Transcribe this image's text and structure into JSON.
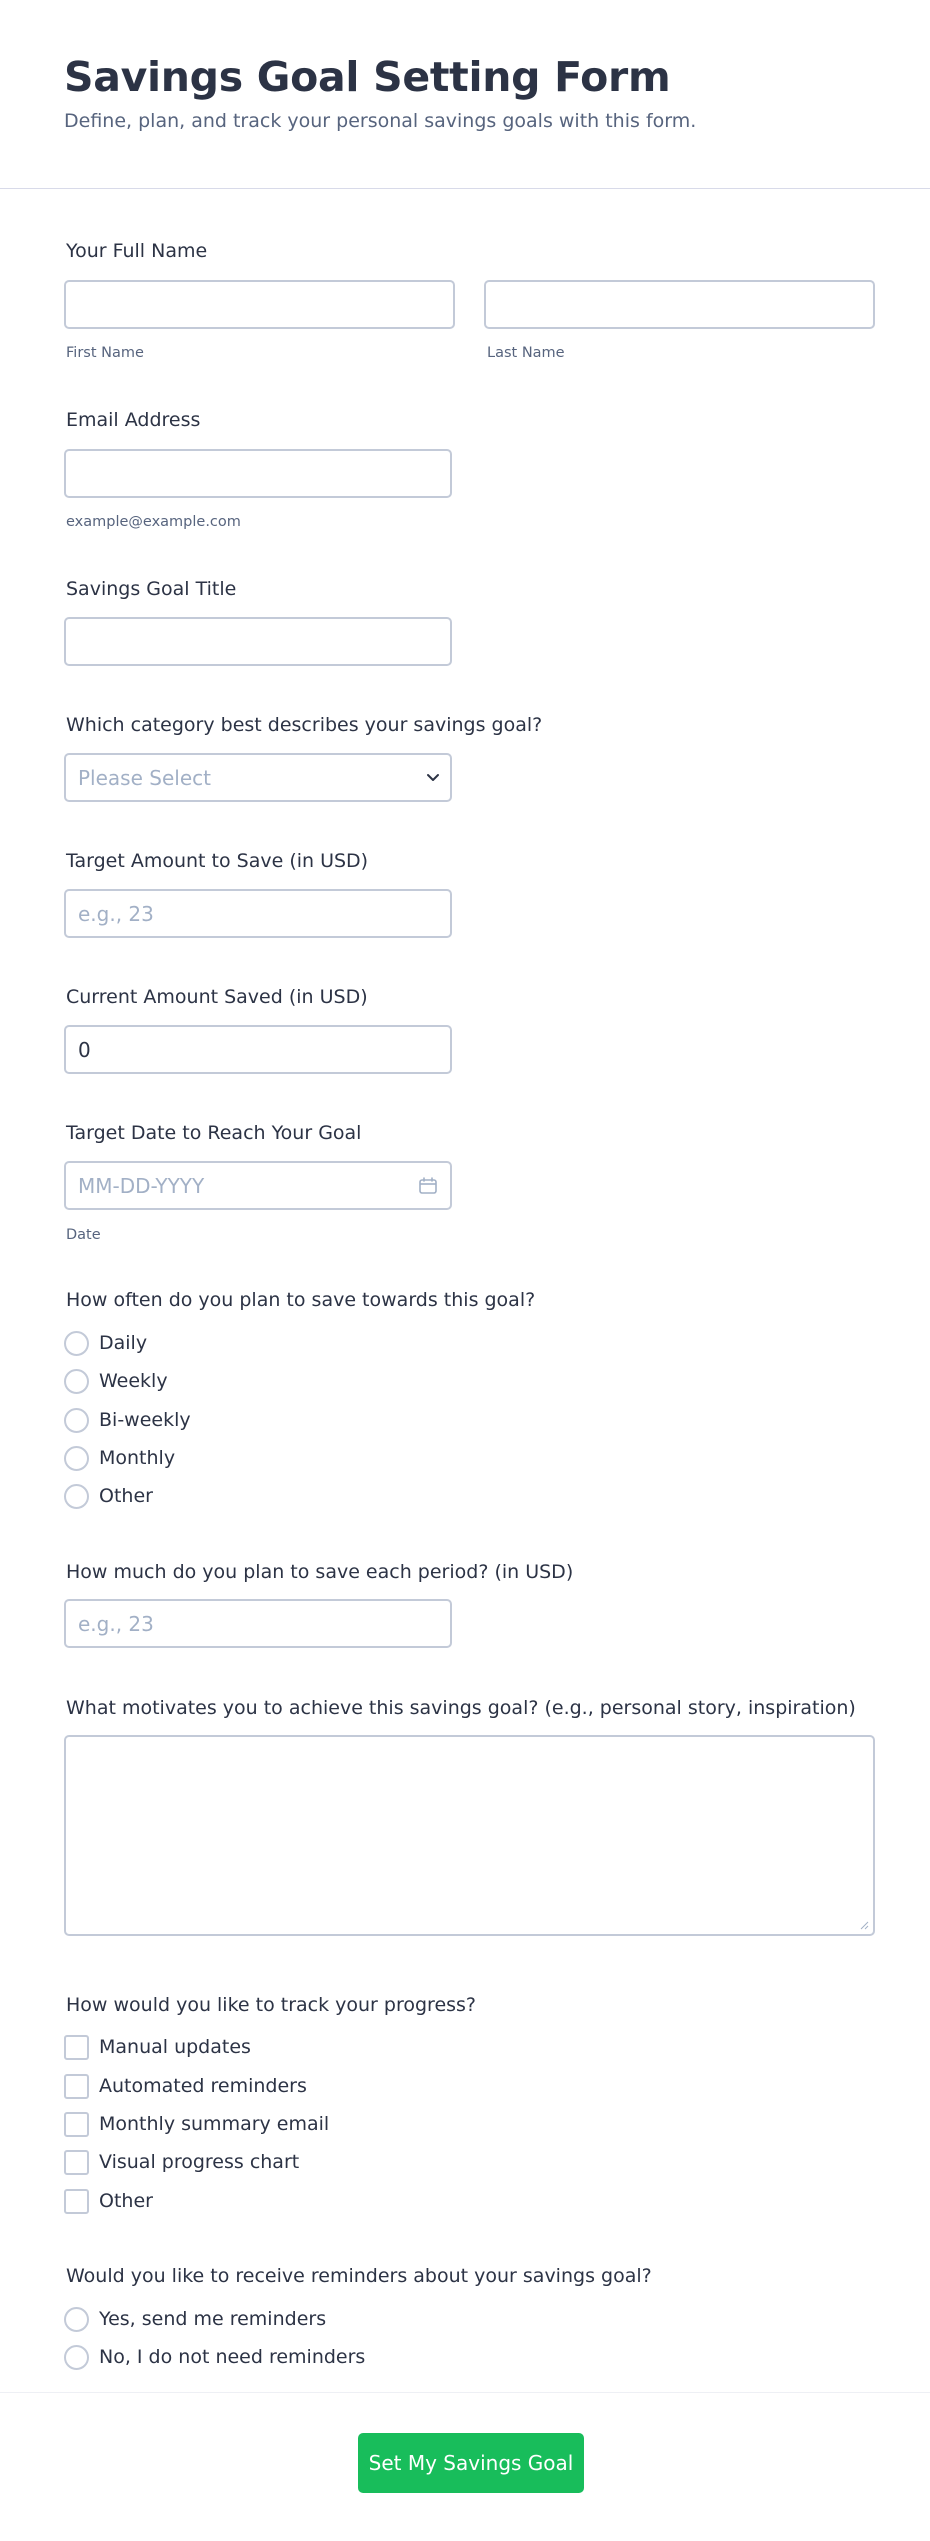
{
  "header": {
    "title": "Savings Goal Setting Form",
    "subtitle": "Define, plan, and track your personal savings goals with this form."
  },
  "full_name": {
    "label": "Your Full Name",
    "first_value": "",
    "last_value": "",
    "first_sublabel": "First Name",
    "last_sublabel": "Last Name"
  },
  "email": {
    "label": "Email Address",
    "value": "",
    "sublabel": "example@example.com"
  },
  "goal_title": {
    "label": "Savings Goal Title",
    "value": ""
  },
  "category": {
    "label": "Which category best describes your savings goal?",
    "selected": "Please Select",
    "icon": "chevron-down-icon"
  },
  "target_amount": {
    "label": "Target Amount to Save (in USD)",
    "placeholder": "e.g., 23"
  },
  "current_amount": {
    "label": "Current Amount Saved (in USD)",
    "value": "0"
  },
  "target_date": {
    "label": "Target Date to Reach Your Goal",
    "placeholder": "MM-DD-YYYY",
    "sublabel": "Date",
    "icon": "calendar-icon"
  },
  "frequency": {
    "label": "How often do you plan to save towards this goal?",
    "options": [
      "Daily",
      "Weekly",
      "Bi-weekly",
      "Monthly",
      "Other"
    ]
  },
  "period_amount": {
    "label": "How much do you plan to save each period? (in USD)",
    "placeholder": "e.g., 23"
  },
  "motivation": {
    "label": "What motivates you to achieve this savings goal? (e.g., personal story, inspiration)",
    "value": ""
  },
  "tracking": {
    "label": "How would you like to track your progress?",
    "options": [
      "Manual updates",
      "Automated reminders",
      "Monthly summary email",
      "Visual progress chart",
      "Other"
    ]
  },
  "reminders": {
    "label": "Would you like to receive reminders about your savings goal?",
    "options": [
      "Yes, send me reminders",
      "No, I do not need reminders"
    ]
  },
  "submit": {
    "label": "Set My Savings Goal"
  },
  "colors": {
    "accent": "#18bd5b",
    "text": "#2c3345",
    "muted": "#57647e",
    "border": "#c3cad8",
    "placeholder": "#a2b0c6"
  }
}
